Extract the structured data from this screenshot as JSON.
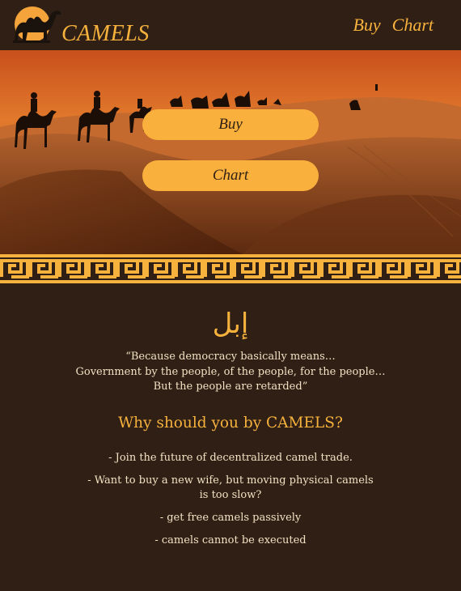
{
  "header": {
    "brand": "CAMELS",
    "nav": [
      {
        "label": "Buy"
      },
      {
        "label": "Chart"
      }
    ]
  },
  "hero": {
    "buttons": [
      {
        "label": "Buy"
      },
      {
        "label": "Chart"
      }
    ]
  },
  "content": {
    "arabic_heading": "إبل",
    "quote_lines": [
      "“Because democracy basically means…",
      "Government by the people, of the people, for the people…",
      "But the people are retarded”"
    ],
    "why_heading": "Why should you by CAMELS?",
    "bullets": [
      "- Join the future of decentralized camel trade.",
      "- Want to buy a new wife, but moving physical camels is too slow?",
      "- get free camels passively",
      "- camels cannot be executed"
    ]
  },
  "colors": {
    "background": "#2f1f14",
    "accent": "#f7b23d",
    "text": "#f3e2c4"
  }
}
